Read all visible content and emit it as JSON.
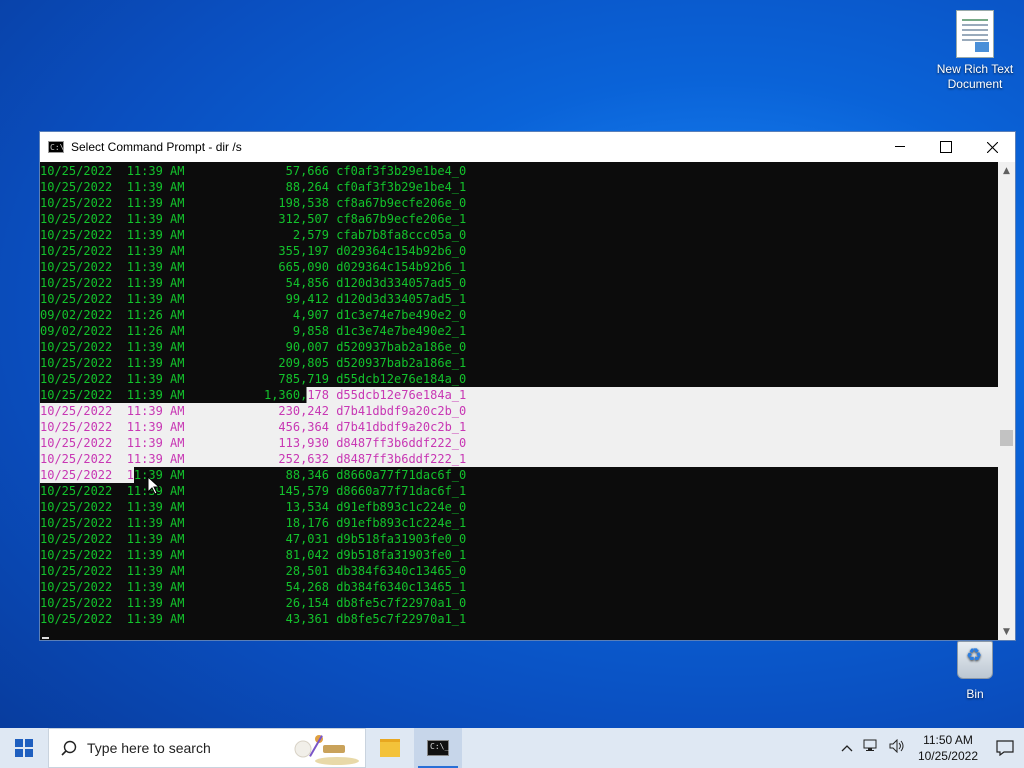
{
  "desktop": {
    "icons": [
      {
        "label_line1": "New Rich Text",
        "label_line2": "Document"
      },
      {
        "label_line1": "Bin",
        "label_line2": ""
      }
    ]
  },
  "window": {
    "title": "Select Command Prompt - dir  /s",
    "minimize": "—",
    "close": "✕"
  },
  "console": {
    "lines": [
      {
        "date": "10/25/2022",
        "time": "11:39 AM",
        "size": "57,666",
        "name": "cf0af3f3b29e1be4_0"
      },
      {
        "date": "10/25/2022",
        "time": "11:39 AM",
        "size": "88,264",
        "name": "cf0af3f3b29e1be4_1"
      },
      {
        "date": "10/25/2022",
        "time": "11:39 AM",
        "size": "198,538",
        "name": "cf8a67b9ecfe206e_0"
      },
      {
        "date": "10/25/2022",
        "time": "11:39 AM",
        "size": "312,507",
        "name": "cf8a67b9ecfe206e_1"
      },
      {
        "date": "10/25/2022",
        "time": "11:39 AM",
        "size": "2,579",
        "name": "cfab7b8fa8ccc05a_0"
      },
      {
        "date": "10/25/2022",
        "time": "11:39 AM",
        "size": "355,197",
        "name": "d029364c154b92b6_0"
      },
      {
        "date": "10/25/2022",
        "time": "11:39 AM",
        "size": "665,090",
        "name": "d029364c154b92b6_1"
      },
      {
        "date": "10/25/2022",
        "time": "11:39 AM",
        "size": "54,856",
        "name": "d120d3d334057ad5_0"
      },
      {
        "date": "10/25/2022",
        "time": "11:39 AM",
        "size": "99,412",
        "name": "d120d3d334057ad5_1"
      },
      {
        "date": "09/02/2022",
        "time": "11:26 AM",
        "size": "4,907",
        "name": "d1c3e74e7be490e2_0"
      },
      {
        "date": "09/02/2022",
        "time": "11:26 AM",
        "size": "9,858",
        "name": "d1c3e74e7be490e2_1"
      },
      {
        "date": "10/25/2022",
        "time": "11:39 AM",
        "size": "90,007",
        "name": "d520937bab2a186e_0"
      },
      {
        "date": "10/25/2022",
        "time": "11:39 AM",
        "size": "209,805",
        "name": "d520937bab2a186e_1"
      },
      {
        "date": "10/25/2022",
        "time": "11:39 AM",
        "size": "785,719",
        "name": "d55dcb12e76e184a_0"
      },
      {
        "date": "10/25/2022",
        "time": "11:39 AM",
        "size": "1,360,178",
        "name": "d55dcb12e76e184a_1"
      },
      {
        "date": "10/25/2022",
        "time": "11:39 AM",
        "size": "230,242",
        "name": "d7b41dbdf9a20c2b_0"
      },
      {
        "date": "10/25/2022",
        "time": "11:39 AM",
        "size": "456,364",
        "name": "d7b41dbdf9a20c2b_1"
      },
      {
        "date": "10/25/2022",
        "time": "11:39 AM",
        "size": "113,930",
        "name": "d8487ff3b6ddf222_0"
      },
      {
        "date": "10/25/2022",
        "time": "11:39 AM",
        "size": "252,632",
        "name": "d8487ff3b6ddf222_1"
      },
      {
        "date": "10/25/2022",
        "time": "11:39 AM",
        "size": "88,346",
        "name": "d8660a77f71dac6f_0"
      },
      {
        "date": "10/25/2022",
        "time": "11:39 AM",
        "size": "145,579",
        "name": "d8660a77f71dac6f_1"
      },
      {
        "date": "10/25/2022",
        "time": "11:39 AM",
        "size": "13,534",
        "name": "d91efb893c1c224e_0"
      },
      {
        "date": "10/25/2022",
        "time": "11:39 AM",
        "size": "18,176",
        "name": "d91efb893c1c224e_1"
      },
      {
        "date": "10/25/2022",
        "time": "11:39 AM",
        "size": "47,031",
        "name": "d9b518fa31903fe0_0"
      },
      {
        "date": "10/25/2022",
        "time": "11:39 AM",
        "size": "81,042",
        "name": "d9b518fa31903fe0_1"
      },
      {
        "date": "10/25/2022",
        "time": "11:39 AM",
        "size": "28,501",
        "name": "db384f6340c13465_0"
      },
      {
        "date": "10/25/2022",
        "time": "11:39 AM",
        "size": "54,268",
        "name": "db384f6340c13465_1"
      },
      {
        "date": "10/25/2022",
        "time": "11:39 AM",
        "size": "26,154",
        "name": "db8fe5c7f22970a1_0"
      },
      {
        "date": "10/25/2022",
        "time": "11:39 AM",
        "size": "43,361",
        "name": "db8fe5c7f22970a1_1"
      }
    ]
  },
  "taskbar": {
    "search_placeholder": "Type here to search",
    "clock_time": "11:50 AM",
    "clock_date": "10/25/2022"
  },
  "colors": {
    "console_text": "#13c32c",
    "selection_text": "#c837b4",
    "selection_bg": "#f0f0f0",
    "accent": "#2a6fd6"
  },
  "icons": {
    "start": "windows-logo-icon",
    "search": "search-icon",
    "file_explorer": "folder-icon",
    "cmd": "command-prompt-icon",
    "tray_chevron": "chevron-up-icon",
    "network": "network-icon",
    "volume": "volume-icon",
    "notifications": "notification-icon"
  }
}
